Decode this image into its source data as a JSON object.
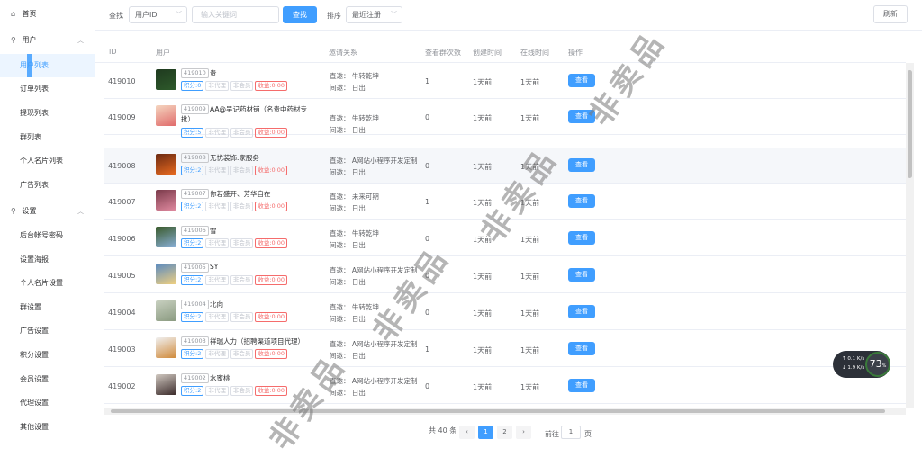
{
  "sidebar": {
    "home": "首页",
    "users_group": "用户",
    "users_items": [
      "用户列表",
      "订单列表",
      "提现列表",
      "群列表",
      "个人名片列表",
      "广告列表"
    ],
    "settings_group": "设置",
    "settings_items": [
      "后台帐号密码",
      "设置海报",
      "个人名片设置",
      "群设置",
      "广告设置",
      "积分设置",
      "会员设置",
      "代理设置",
      "其他设置"
    ]
  },
  "toolbar": {
    "search_label": "查找",
    "search_field_value": "用户ID",
    "keyword_placeholder": "输入关键词",
    "search_button": "查找",
    "sort_label": "排序",
    "sort_value": "最近注册",
    "refresh_button": "刷新"
  },
  "table": {
    "headers": [
      "ID",
      "用户",
      "邀请关系",
      "查看群次数",
      "创建时间",
      "在线时间",
      "操作"
    ],
    "rows": [
      {
        "id": "419010",
        "uid": "419010",
        "name": "贵",
        "points": "积分:0",
        "agent": "非代理",
        "member": "非会员",
        "income": "收益:0.00",
        "direct": "直邀：  牛转乾坤",
        "indirect": "间邀：  日出",
        "views": "1",
        "created": "1天前",
        "online": "1天前",
        "action": "查看"
      },
      {
        "id": "419009",
        "uid": "419009",
        "name": "AA@吴记药材铺（名贵中药材专",
        "name2": "批）",
        "points": "积分:5",
        "agent": "非代理",
        "member": "非会员",
        "income": "收益:0.00",
        "direct": "直邀：  牛转乾坤",
        "indirect": "间邀：  日出",
        "views": "0",
        "created": "1天前",
        "online": "1天前",
        "action": "查看"
      },
      {
        "id": "419008",
        "uid": "419008",
        "name": "无忧装饰.家服务",
        "points": "积分:2",
        "agent": "非代理",
        "member": "非会员",
        "income": "收益:0.00",
        "direct": "直邀：  A网站小程序开发定制",
        "indirect": "间邀：  日出",
        "views": "0",
        "created": "1天前",
        "online": "1天前",
        "action": "查看"
      },
      {
        "id": "419007",
        "uid": "419007",
        "name": "你若盛开、芳华自在",
        "points": "积分:2",
        "agent": "非代理",
        "member": "非会员",
        "income": "收益:0.00",
        "direct": "直邀：  未来可期",
        "indirect": "间邀：  日出",
        "views": "1",
        "created": "1天前",
        "online": "1天前",
        "action": "查看"
      },
      {
        "id": "419006",
        "uid": "419006",
        "name": "雪",
        "points": "积分:2",
        "agent": "非代理",
        "member": "非会员",
        "income": "收益:0.00",
        "direct": "直邀：  牛转乾坤",
        "indirect": "间邀：  日出",
        "views": "0",
        "created": "1天前",
        "online": "1天前",
        "action": "查看"
      },
      {
        "id": "419005",
        "uid": "419005",
        "name": "SY",
        "points": "积分:2",
        "agent": "非代理",
        "member": "非会员",
        "income": "收益:0.00",
        "direct": "直邀：  A网站小程序开发定制",
        "indirect": "间邀：  日出",
        "views": "0",
        "created": "1天前",
        "online": "1天前",
        "action": "查看"
      },
      {
        "id": "419004",
        "uid": "419004",
        "name": "北向",
        "points": "积分:2",
        "agent": "非代理",
        "member": "非会员",
        "income": "收益:0.00",
        "direct": "直邀：  牛转乾坤",
        "indirect": "间邀：  日出",
        "views": "0",
        "created": "1天前",
        "online": "1天前",
        "action": "查看"
      },
      {
        "id": "419003",
        "uid": "419003",
        "name": "祥瑞人力（招聘渠道项目代理）",
        "points": "积分:2",
        "agent": "非代理",
        "member": "非会员",
        "income": "收益:0.00",
        "direct": "直邀：  A网站小程序开发定制",
        "indirect": "间邀：  日出",
        "views": "1",
        "created": "1天前",
        "online": "1天前",
        "action": "查看"
      },
      {
        "id": "419002",
        "uid": "419002",
        "name": "水蜜桃",
        "points": "积分:2",
        "agent": "非代理",
        "member": "非会员",
        "income": "收益:0.00",
        "direct": "直邀：  A网站小程序开发定制",
        "indirect": "间邀：  日出",
        "views": "0",
        "created": "1天前",
        "online": "1天前",
        "action": "查看"
      }
    ]
  },
  "pagination": {
    "total": "共 40 条",
    "prev": "‹",
    "pages": [
      "1",
      "2"
    ],
    "next": "›",
    "goto_label": "前往",
    "goto_value": "1",
    "page_suffix": "页"
  },
  "net_widget": {
    "up": "0.1",
    "up_unit": "K/s",
    "down": "1.9",
    "down_unit": "K/s",
    "percent": "73",
    "percent_unit": "%"
  },
  "watermark": "非卖品",
  "colors": {
    "primary": "#409eff",
    "danger": "#f56c6c",
    "hover_row": "#f5f7fa"
  }
}
